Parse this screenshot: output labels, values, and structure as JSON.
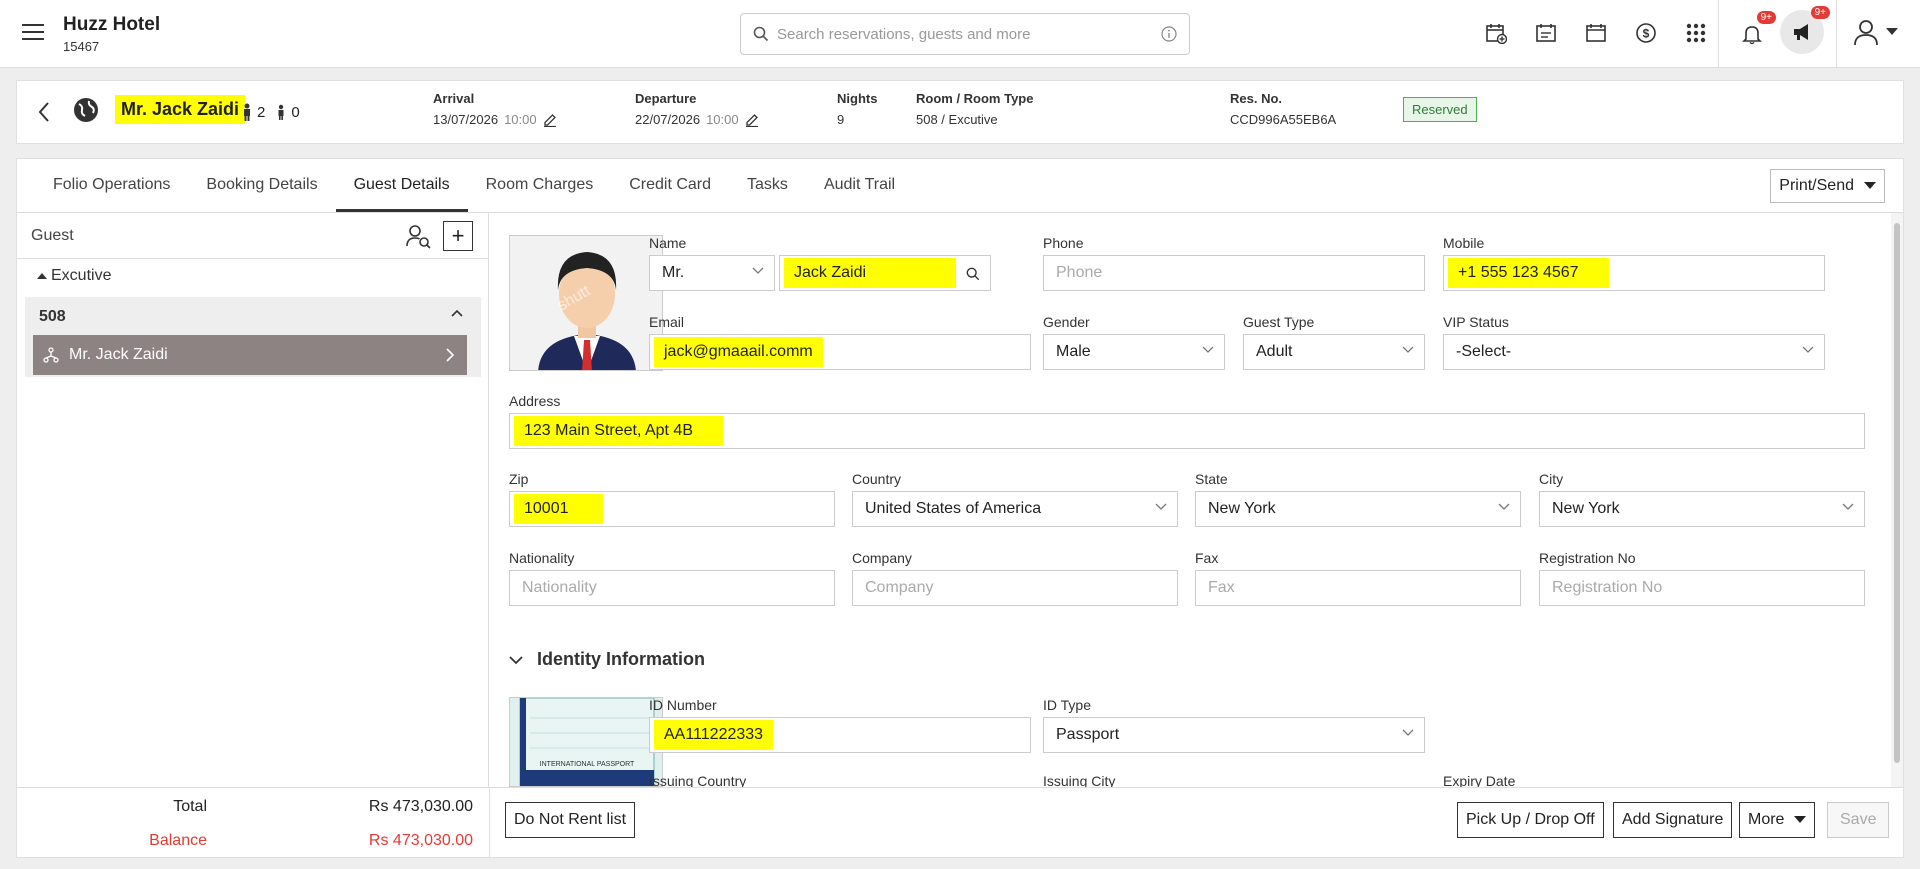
{
  "app": {
    "hotel_name": "Huzz Hotel",
    "hotel_code": "15467",
    "search_placeholder": "Search reservations, guests and more",
    "notif_badge": "9+",
    "announce_badge": "9+"
  },
  "reservation": {
    "guest_name": "Mr. Jack Zaidi",
    "adults": "2",
    "children": "0",
    "arrival_label": "Arrival",
    "arrival_date": "13/07/2026",
    "arrival_time": "10:00",
    "departure_label": "Departure",
    "departure_date": "22/07/2026",
    "departure_time": "10:00",
    "nights_label": "Nights",
    "nights": "9",
    "room_label": "Room / Room Type",
    "room": "508 / Excutive",
    "resno_label": "Res. No.",
    "resno": "CCD996A55EB6A",
    "status": "Reserved"
  },
  "tabs": [
    "Folio Operations",
    "Booking Details",
    "Guest Details",
    "Room Charges",
    "Credit Card",
    "Tasks",
    "Audit Trail"
  ],
  "print_send": "Print/Send",
  "sidebar": {
    "guest_label": "Guest",
    "plus": "+",
    "group": "Excutive",
    "room": "508",
    "guest": "Mr. Jack Zaidi"
  },
  "form": {
    "name_label": "Name",
    "title": "Mr.",
    "name": "Jack Zaidi",
    "phone_label": "Phone",
    "phone_placeholder": "Phone",
    "mobile_label": "Mobile",
    "mobile": "+1 555 123 4567",
    "email_label": "Email",
    "email": "jack@gmaaail.comm",
    "gender_label": "Gender",
    "gender": "Male",
    "guest_type_label": "Guest Type",
    "guest_type": "Adult",
    "vip_label": "VIP Status",
    "vip": "-Select-",
    "address_label": "Address",
    "address": "123 Main Street, Apt 4B",
    "zip_label": "Zip",
    "zip": "10001",
    "country_label": "Country",
    "country": "United States of America",
    "state_label": "State",
    "state": "New York",
    "city_label": "City",
    "city": "New York",
    "nationality_label": "Nationality",
    "nationality_placeholder": "Nationality",
    "company_label": "Company",
    "company_placeholder": "Company",
    "fax_label": "Fax",
    "fax_placeholder": "Fax",
    "regno_label": "Registration No",
    "regno_placeholder": "Registration No",
    "identity_title": "Identity Information",
    "id_number_label": "ID Number",
    "id_number": "AA111222333",
    "id_type_label": "ID Type",
    "id_type": "Passport",
    "issuing_country_label": "Issuing Country",
    "issuing_city_label": "Issuing City",
    "expiry_label": "Expiry Date",
    "passport_caption": "INTERNATIONAL PASSPORT"
  },
  "footer": {
    "total_label": "Total",
    "total": "Rs 473,030.00",
    "balance_label": "Balance",
    "balance": "Rs 473,030.00",
    "do_not_rent": "Do Not Rent list",
    "pickup": "Pick Up / Drop Off",
    "signature": "Add Signature",
    "more": "More",
    "save": "Save"
  },
  "colors": {
    "highlight": "#ffff00",
    "status_green": "#2e7d32",
    "balance_red": "#e53935",
    "selected_guest_bg": "#8d8383"
  }
}
